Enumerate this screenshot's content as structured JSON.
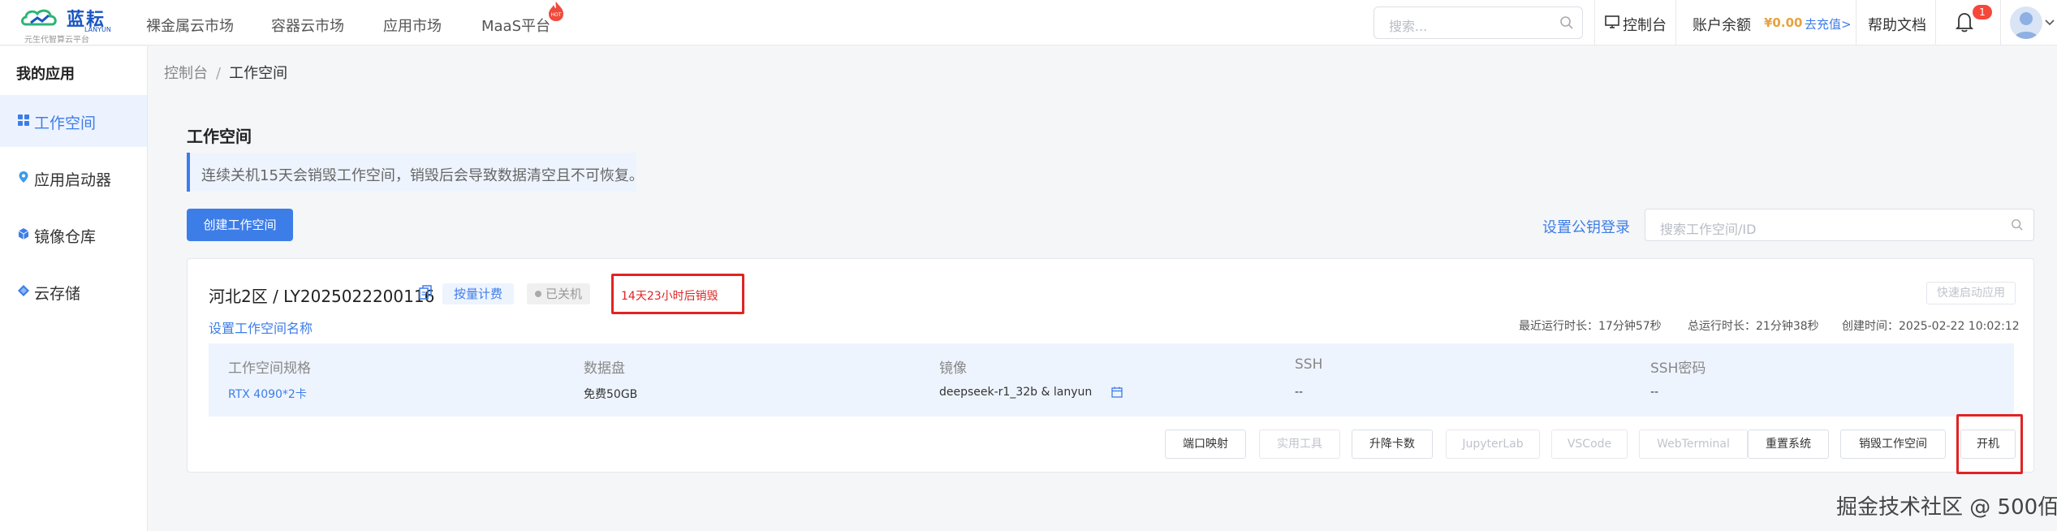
{
  "brand": {
    "name": "蓝耘",
    "en": "LANYUN",
    "subtitle": "元生代智算云平台"
  },
  "nav": [
    "裸金属云市场",
    "容器云市场",
    "应用市场",
    "MaaS平台"
  ],
  "nav_hot_badge": "HOT",
  "top_search": {
    "placeholder": "搜索..."
  },
  "topbar": {
    "console": "控制台",
    "balance_label": "账户余额",
    "balance_amount": "¥0.00",
    "recharge": "去充值>",
    "help": "帮助文档",
    "notifications": "1"
  },
  "sidebar": {
    "title": "我的应用",
    "items": [
      {
        "label": "工作空间",
        "active": true
      },
      {
        "label": "应用启动器",
        "active": false
      },
      {
        "label": "镜像仓库",
        "active": false
      },
      {
        "label": "云存储",
        "active": false
      }
    ]
  },
  "breadcrumb": {
    "parent": "控制台",
    "sep": "/",
    "current": "工作空间"
  },
  "page": {
    "title": "工作空间",
    "notice": "连续关机15天会销毁工作空间，销毁后会导致数据清空且不可恢复。",
    "create_button": "创建工作空间",
    "pubkey_link": "设置公钥登录",
    "search_placeholder": "搜索工作空间/ID"
  },
  "workspace": {
    "name": "河北2区 / LY2025022200116",
    "billing_tag": "按量计费",
    "status": "已关机",
    "destroy_countdown": "14天23小时后销毁",
    "quick_start": "快速启动应用",
    "rename_link": "设置工作空间名称",
    "meta": {
      "recent_runtime": "最近运行时长：17分钟57秒",
      "total_runtime": "总运行时长：21分钟38秒",
      "created": "创建时间：2025-02-22 10:02:12"
    },
    "specs": [
      {
        "label": "工作空间规格",
        "value": "RTX 4090*2卡"
      },
      {
        "label": "数据盘",
        "value": "免费50GB"
      },
      {
        "label": "镜像",
        "value": "deepseek-r1_32b & lanyun"
      },
      {
        "label": "SSH",
        "value": "--"
      },
      {
        "label": "SSH密码",
        "value": "--"
      }
    ],
    "actions": [
      {
        "label": "端口映射",
        "disabled": false
      },
      {
        "label": "实用工具",
        "disabled": true
      },
      {
        "label": "升降卡数",
        "disabled": false
      },
      {
        "label": "JupyterLab",
        "disabled": true
      },
      {
        "label": "VSCode",
        "disabled": true
      },
      {
        "label": "WebTerminal",
        "disabled": true
      },
      {
        "label": "重置系统",
        "disabled": false
      },
      {
        "label": "销毁工作空间",
        "disabled": false
      },
      {
        "label": "开机",
        "disabled": false
      }
    ]
  },
  "watermark": "掘金技术社区 @ 500佰",
  "colors": {
    "accent": "#3d7de8",
    "danger": "#e02424",
    "balance": "#e6a23c"
  }
}
